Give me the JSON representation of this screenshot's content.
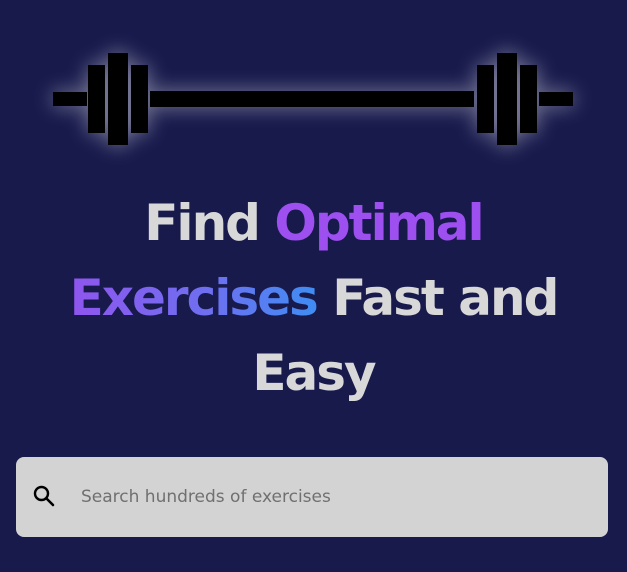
{
  "logo": {
    "icon": "barbell-icon"
  },
  "headline": {
    "line1_plain": "Find ",
    "line1_accent": "Optimal",
    "line2_accent": "Exercises",
    "line2_plain": " Fast and",
    "line3_plain": "Easy"
  },
  "search": {
    "icon": "search-icon",
    "placeholder": "Search hundreds of exercises",
    "value": ""
  },
  "colors": {
    "background": "#181a4c",
    "text": "#d8d8d8",
    "accent_purple": "#9d4ff0",
    "accent_blue": "#3f8df3",
    "search_bg": "#d3d3d3"
  }
}
